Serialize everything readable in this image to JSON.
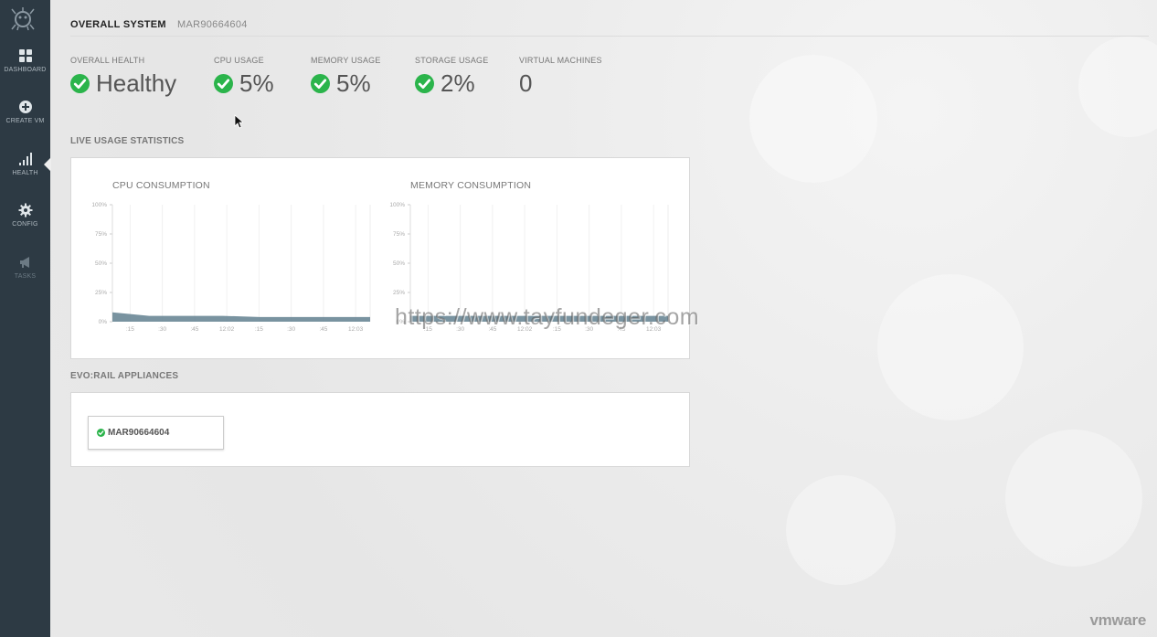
{
  "sidebar": {
    "items": [
      {
        "label": "DASHBOARD",
        "icon": "dashboard-grid-icon"
      },
      {
        "label": "CREATE VM",
        "icon": "plus-circle-icon"
      },
      {
        "label": "HEALTH",
        "icon": "signal-bars-icon"
      },
      {
        "label": "CONFIG",
        "icon": "gear-icon"
      },
      {
        "label": "TASKS",
        "icon": "megaphone-icon"
      }
    ],
    "active": "HEALTH"
  },
  "tabs": [
    {
      "label": "OVERALL SYSTEM",
      "active": true
    },
    {
      "label": "MAR90664604",
      "active": false
    }
  ],
  "stats": [
    {
      "label": "OVERALL HEALTH",
      "value": "Healthy",
      "status": "ok"
    },
    {
      "label": "CPU USAGE",
      "value": "5%",
      "status": "ok"
    },
    {
      "label": "MEMORY USAGE",
      "value": "5%",
      "status": "ok"
    },
    {
      "label": "STORAGE USAGE",
      "value": "2%",
      "status": "ok"
    },
    {
      "label": "VIRTUAL MACHINES",
      "value": "0",
      "status": "none"
    }
  ],
  "live_usage": {
    "title": "LIVE USAGE STATISTICS",
    "y_ticks": [
      "100%",
      "75%",
      "50%",
      "25%",
      "0%"
    ],
    "x_ticks": [
      ":15",
      ":30",
      ":45",
      "12:02",
      ":15",
      ":30",
      ":45",
      "12:03"
    ],
    "cpu": {
      "title": "CPU CONSUMPTION"
    },
    "memory": {
      "title": "MEMORY CONSUMPTION"
    }
  },
  "chart_data": [
    {
      "type": "area",
      "title": "CPU CONSUMPTION",
      "ylim": [
        0,
        100
      ],
      "x": [
        ":15",
        ":30",
        ":45",
        "12:02",
        ":15",
        ":30",
        ":45",
        "12:03"
      ],
      "series": [
        {
          "values": [
            8,
            5,
            5,
            5,
            4,
            4,
            4,
            4
          ]
        }
      ]
    },
    {
      "type": "area",
      "title": "MEMORY CONSUMPTION",
      "ylim": [
        0,
        100
      ],
      "x": [
        ":15",
        ":30",
        ":45",
        "12:02",
        ":15",
        ":30",
        ":45",
        "12:03"
      ],
      "series": [
        {
          "values": [
            5,
            5,
            5,
            5,
            5,
            5,
            5,
            5
          ]
        }
      ]
    }
  ],
  "appliances": {
    "title": "EVO:RAIL APPLIANCES",
    "items": [
      {
        "label": "MAR90664604",
        "status": "ok"
      }
    ]
  },
  "watermark": "https://www.tayfundeger.com",
  "brand": "vmware",
  "colors": {
    "sidebar": "#2d3a44",
    "ok_green": "#2bb44b",
    "chart_fill": "#6a8796"
  }
}
